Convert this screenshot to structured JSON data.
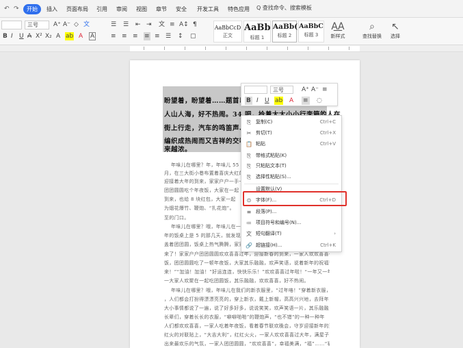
{
  "menubar": {
    "start_tab": "开始",
    "tabs": [
      "插入",
      "页面布局",
      "引用",
      "审阅",
      "视图",
      "章节",
      "安全",
      "开发工具",
      "特色应用"
    ],
    "search": "Q 查找命令、搜索模板"
  },
  "ribbon": {
    "font_name": "三号",
    "font_tools": [
      "A⁺",
      "A⁻",
      "◇",
      "文"
    ],
    "format_row": [
      "B",
      "I",
      "U",
      "A",
      "X²",
      "X₂",
      "A",
      "ab",
      "A",
      "A"
    ],
    "para_row1": [
      "☰",
      "☰",
      "⇤",
      "⇥",
      "文",
      "≡",
      "A↕",
      "¶"
    ],
    "para_row2": [
      "≡",
      "≡",
      "≡",
      "≡",
      "≡",
      "☰",
      "↕",
      "▢"
    ],
    "styles": [
      {
        "sample": "AaBbCcD",
        "label": "正文"
      },
      {
        "sample": "AaBb",
        "label": "标题 1"
      },
      {
        "sample": "AaBb(",
        "label": "标题 2"
      },
      {
        "sample": "AaBbC",
        "label": "标题 3"
      }
    ],
    "new_style": "新样式",
    "find_replace": "查找替换",
    "select": "选择"
  },
  "document": {
    "selected_lines": [
      "盼望着，盼望着……题首以明",
      "人山人海，好不热闹。34 吧，拎着大大小小行李箱的人在",
      "街上行走，汽车的鸣笛声、商",
      "编织成热闹而又吉祥的交响乐",
      "来越浓。"
    ],
    "body_lines": [
      "年味儿在哪里？年，年味儿 55 年",
      "月，在三大街小巷布置着喜庆大红的春",
      "迎接着大年的到来，家家户户一手一手",
      "团团圆圆吃个年夜饭，大家在一起",
      "到来，也给 8 块红包，大家一起",
      "为烟花爆竹、鞭炮、“扎花炮”。",
      "至的门口。",
      "年味儿在哪里？哦，年味儿在一大",
      "年的饭桌上是 5 的那几天，就发现自己",
      "盖着团团圆，饭桌上热气腾腾，家家户户",
      "来了！家家户户团团圆圆欢欢喜喜过年，迎接新春的到来，一家人欢欢喜喜一起吃",
      "饭，团团圆圆吃了一顿年夜饭，大家其乐融融，欢声笑语，说着新年的祝福话语",
      "来！”“加油！加油！”好运连连，快快乐乐！”欢欢喜喜过年啦！“一年又一年",
      "一大家人欢聚在一起吃团圆饭，其乐融融，欢欢喜喜，好不热闹。",
      "年味儿在哪里？哦，年味儿在我们的新衣服里，“过年咯！”穿着新衣服，美美的",
      "，人们都会打扮得漂漂亮亮的，穿上新衣，戴上新帽，高高兴兴地，去拜年，走亲访友",
      "大小事情都说了一遍，说了好多好多，说说笑笑，欢声笑语一片，其乐融融，热热闹闹",
      "长辈们，穿着长长的衣服，“噼噼啪啪”的鞭炮声，“也不错”的一种一种年",
      "人们都欢欢喜喜，一家人吃着年夜饭，看着春节联欢晚会，守岁迎接新年的到来",
      "红火的对联贴上，“大吉大利”，红红火火，一家人欢欢喜喜过大年，满屋子里",
      "出来最欢乐的气氛，一家人团团圆圆，“欢欢喜喜”，幸福美满，“福”……“福”"
    ]
  },
  "minibar": {
    "font_size": "三号",
    "row1": [
      "A⁺",
      "A⁻",
      "≡"
    ],
    "row2": [
      "B",
      "I",
      "U",
      "ab",
      "A",
      "≡",
      "◌"
    ]
  },
  "context_menu": {
    "items": [
      {
        "icon": "⎘",
        "label": "复制(C)",
        "key": "Ctrl+C",
        "name": "copy"
      },
      {
        "icon": "✂",
        "label": "剪切(T)",
        "key": "Ctrl+X",
        "name": "cut"
      },
      {
        "icon": "📋",
        "label": "粘贴",
        "key": "Ctrl+V",
        "name": "paste"
      },
      {
        "icon": "⎘",
        "label": "带格式粘贴(K)",
        "key": "",
        "name": "paste-keep-format"
      },
      {
        "icon": "⎘",
        "label": "只粘贴文本(T)",
        "key": "",
        "name": "paste-text-only"
      },
      {
        "icon": "⎘",
        "label": "选择性粘贴(S)...",
        "key": "",
        "name": "paste-special"
      },
      {
        "icon": "",
        "label": "设置默认(V)",
        "key": "",
        "name": "set-default"
      },
      {
        "icon": "⊙",
        "label": "字体(F)...",
        "key": "Ctrl+D",
        "name": "font"
      },
      {
        "icon": "≡",
        "label": "段落(P)...",
        "key": "",
        "name": "paragraph"
      },
      {
        "icon": "≔",
        "label": "项目符号和编号(N)...",
        "key": "",
        "name": "bullets-numbering"
      },
      {
        "icon": "文",
        "label": "短句翻译(T)",
        "key": "›",
        "name": "translate"
      },
      {
        "icon": "🔗",
        "label": "超链接(H)...",
        "key": "Ctrl+K",
        "name": "hyperlink"
      }
    ]
  },
  "colors": {
    "accent": "#2f6fed",
    "highlight_border": "#e0302a",
    "selection": "#c8c8c8"
  }
}
